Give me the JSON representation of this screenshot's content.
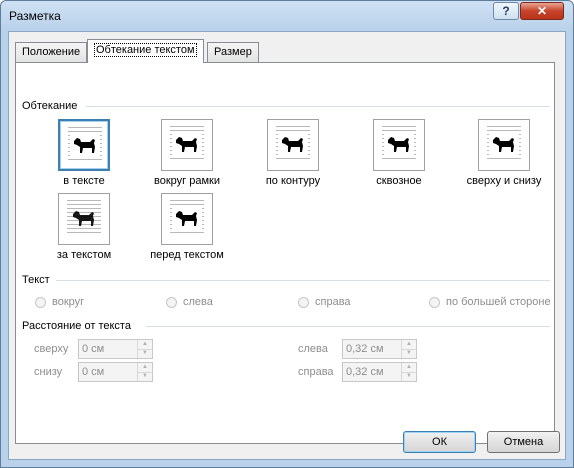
{
  "window": {
    "title": "Разметка",
    "help_icon": "help-icon",
    "close_icon": "close-icon"
  },
  "tabs": [
    {
      "label": "Положение",
      "active": false
    },
    {
      "label": "Обтекание текстом",
      "active": true
    },
    {
      "label": "Размер",
      "active": false
    }
  ],
  "wrapping": {
    "group_title": "Обтекание",
    "options": [
      {
        "id": "inline",
        "label": "в тексте",
        "selected": true
      },
      {
        "id": "square",
        "label": "вокруг рамки",
        "selected": false
      },
      {
        "id": "tight",
        "label": "по контуру",
        "selected": false
      },
      {
        "id": "through",
        "label": "сквозное",
        "selected": false
      },
      {
        "id": "topbottom",
        "label": "сверху и снизу",
        "selected": false
      },
      {
        "id": "behind",
        "label": "за текстом",
        "selected": false
      },
      {
        "id": "front",
        "label": "перед текстом",
        "selected": false
      }
    ]
  },
  "text": {
    "group_title": "Текст",
    "options": [
      {
        "label": "вокруг",
        "enabled": false
      },
      {
        "label": "слева",
        "enabled": false
      },
      {
        "label": "справа",
        "enabled": false
      },
      {
        "label": "по большей стороне",
        "enabled": false
      }
    ]
  },
  "distance": {
    "group_title": "Расстояние от текста",
    "top_label": "сверху",
    "top_value": "0 см",
    "bottom_label": "снизу",
    "bottom_value": "0 см",
    "left_label": "слева",
    "left_value": "0,32 см",
    "right_label": "справа",
    "right_value": "0,32 см"
  },
  "buttons": {
    "ok": "ОК",
    "cancel": "Отмена"
  },
  "colors": {
    "selection_border": "#3c7fb1",
    "title_gradient_top": "#cfe1f3"
  }
}
